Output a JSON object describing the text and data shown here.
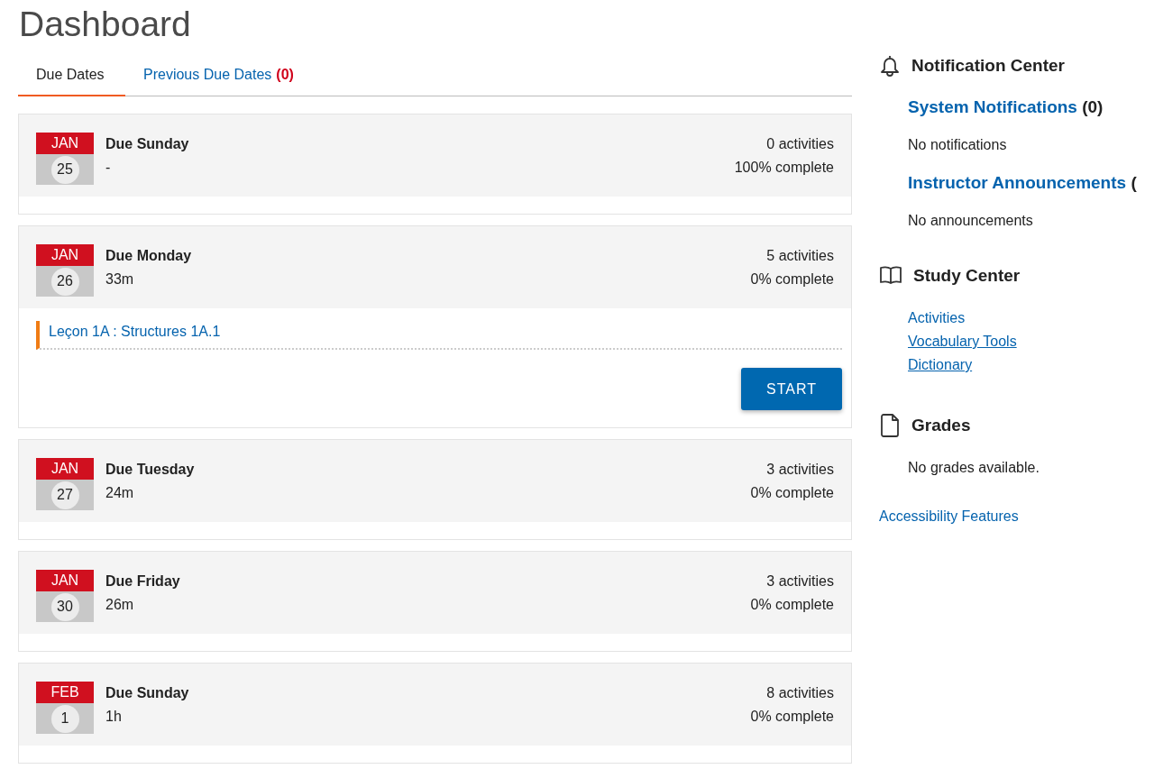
{
  "title": "Dashboard",
  "tabs": [
    {
      "label": "Due Dates",
      "selected": true
    },
    {
      "label": "Previous Due Dates",
      "count": "(0)",
      "selected": false
    }
  ],
  "due_groups": [
    {
      "month": "JAN",
      "day": "25",
      "title": "Due Sunday",
      "time": "-",
      "activities": "0 activities",
      "complete": "100% complete",
      "expanded": false
    },
    {
      "month": "JAN",
      "day": "26",
      "title": "Due Monday",
      "time": "33m",
      "activities": "5 activities",
      "complete": "0% complete",
      "expanded": true,
      "items": [
        {
          "title": "Leçon 1A : Structures 1A.1"
        }
      ],
      "button": "START"
    },
    {
      "month": "JAN",
      "day": "27",
      "title": "Due Tuesday",
      "time": "24m",
      "activities": "3 activities",
      "complete": "0% complete",
      "expanded": false
    },
    {
      "month": "JAN",
      "day": "30",
      "title": "Due Friday",
      "time": "26m",
      "activities": "3 activities",
      "complete": "0% complete",
      "expanded": false
    },
    {
      "month": "FEB",
      "day": "1",
      "title": "Due Sunday",
      "time": "1h",
      "activities": "8 activities",
      "complete": "0% complete",
      "expanded": false
    }
  ],
  "sidebar": {
    "notification_center": {
      "heading": "Notification Center",
      "sections": [
        {
          "title": "System Notifications",
          "count": "(0)",
          "empty_text": "No notifications"
        },
        {
          "title": "Instructor Announcements",
          "count": "(",
          "empty_text": "No announcements"
        }
      ]
    },
    "study_center": {
      "heading": "Study Center",
      "links": [
        {
          "label": "Activities",
          "underlined": false
        },
        {
          "label": "Vocabulary Tools",
          "underlined": true
        },
        {
          "label": "Dictionary",
          "underlined": true
        }
      ]
    },
    "grades": {
      "heading": "Grades",
      "empty_text": "No grades available."
    },
    "footer_link": "Accessibility Features"
  }
}
